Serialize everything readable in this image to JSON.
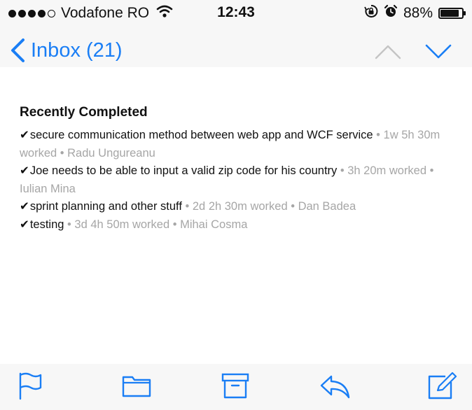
{
  "status_bar": {
    "carrier": "Vodafone RO",
    "time": "12:43",
    "battery_percent": "88%",
    "battery_level": 0.88,
    "signal_bars_filled": 4,
    "signal_bars_total": 5
  },
  "nav": {
    "back_label": "Inbox (21)"
  },
  "content": {
    "section_title": "Recently Completed",
    "check_mark": "✔",
    "tasks": [
      {
        "title": "secure communication method between web app and WCF service",
        "meta": " • 1w 5h 30m worked • Radu Ungureanu"
      },
      {
        "title": "Joe needs to be able to input a valid zip code for his country",
        "meta": " • 3h 20m worked • Iulian Mina"
      },
      {
        "title": "sprint planning and other stuff",
        "meta": " • 2d 2h 30m worked • Dan Badea"
      },
      {
        "title": "testing",
        "meta": " • 3d 4h 50m worked • Mihai Cosma"
      }
    ]
  },
  "toolbar": {
    "icons": [
      "flag-icon",
      "folder-icon",
      "archive-icon",
      "reply-icon",
      "compose-icon"
    ]
  },
  "colors": {
    "accent": "#1a7ef5",
    "meta_text": "#a6a6a6",
    "disabled_arrow": "#c4c4c4",
    "chrome_bg": "#f7f7f7"
  }
}
